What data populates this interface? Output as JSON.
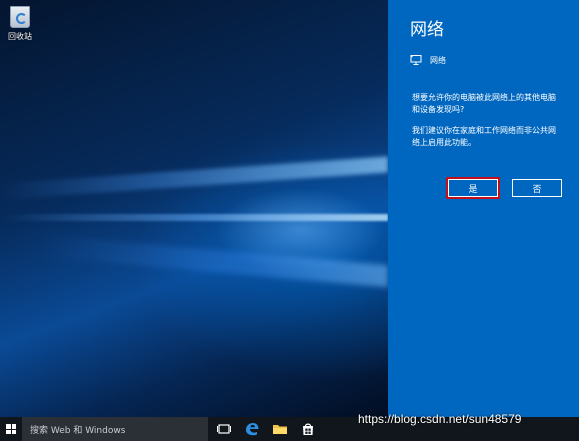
{
  "desktop": {
    "recycle_bin_label": "回收站"
  },
  "network_panel": {
    "title": "网络",
    "network_name": "网络",
    "question": "想要允许你的电脑被此网络上的其他电脑和设备发现吗?",
    "advice": "我们建议你在家庭和工作网络而非公共网络上启用此功能。",
    "yes_label": "是",
    "no_label": "否",
    "background_color": "#0067c0",
    "highlight_color": "#c0101a"
  },
  "taskbar": {
    "search_placeholder": "搜索 Web 和 Windows",
    "icons": [
      "task-view-icon",
      "edge-icon",
      "file-explorer-icon",
      "store-icon"
    ]
  },
  "watermark": "https://blog.csdn.net/sun48579"
}
